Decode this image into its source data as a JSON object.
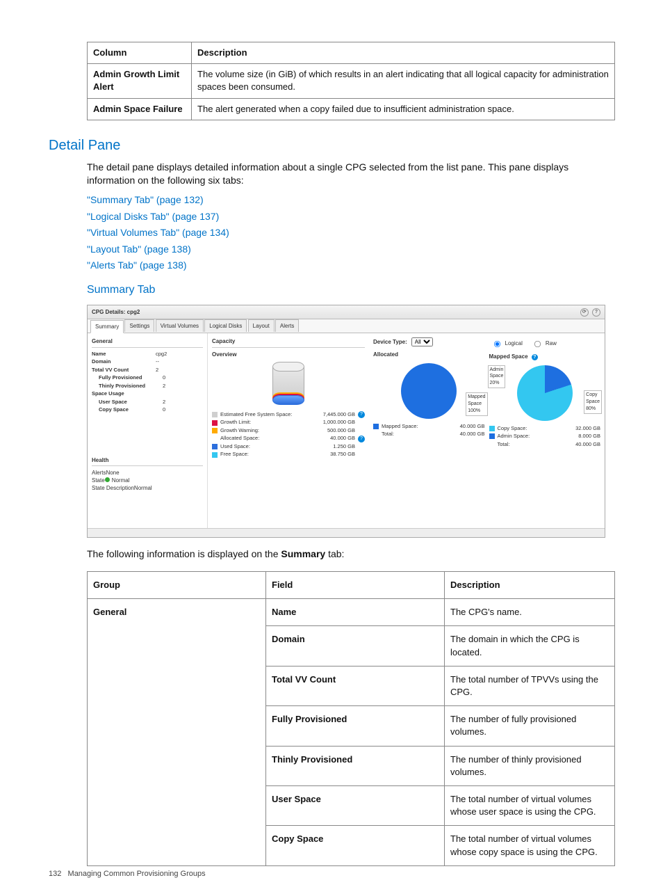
{
  "top_table": {
    "headers": [
      "Column",
      "Description"
    ],
    "rows": [
      {
        "col": "Admin Growth Limit Alert",
        "desc": "The volume size (in GiB) of which results in an alert indicating that all logical capacity for administration spaces been consumed."
      },
      {
        "col": "Admin Space Failure",
        "desc": "The alert generated when a copy failed due to insufficient administration space."
      }
    ]
  },
  "section_heading": "Detail Pane",
  "intro": "The detail pane displays detailed information about a single CPG selected from the list pane. This pane displays information on the following six tabs:",
  "links": [
    "\"Summary Tab\" (page 132)",
    "\"Logical Disks Tab\" (page 137)",
    "\"Virtual Volumes Tab\" (page 134)",
    "\"Layout Tab\" (page 138)",
    "\"Alerts Tab\" (page 138)"
  ],
  "subheading": "Summary Tab",
  "screenshot": {
    "title": "CPG Details: cpg2",
    "tabs": [
      "Summary",
      "Settings",
      "Virtual Volumes",
      "Logical Disks",
      "Layout",
      "Alerts"
    ],
    "general_title": "General",
    "capacity_title": "Capacity",
    "general": [
      {
        "k": "Name",
        "v": "cpg2"
      },
      {
        "k": "Domain",
        "v": "--"
      },
      {
        "k": "Total VV Count",
        "v": "2"
      },
      {
        "k": "Fully Provisioned",
        "v": "0",
        "ind": true
      },
      {
        "k": "Thinly Provisioned",
        "v": "2",
        "ind": true
      },
      {
        "k": "Space Usage",
        "v": ""
      },
      {
        "k": "User Space",
        "v": "2",
        "ind": true
      },
      {
        "k": "Copy Space",
        "v": "0",
        "ind": true
      }
    ],
    "overview_title": "Overview",
    "overview_legend": [
      {
        "color": "#cfcfcf",
        "label": "Estimated Free System Space:",
        "value": "7,445.000 GB",
        "help": true
      },
      {
        "color": "#d14",
        "label": "Growth Limit:",
        "value": "1,000.000 GB"
      },
      {
        "color": "#fa0",
        "label": "Growth Warning:",
        "value": "500.000 GB"
      },
      {
        "color": "",
        "label": "Allocated Space:",
        "value": "40.000 GB",
        "help": true,
        "nobox": true
      },
      {
        "color": "#2d6fdc",
        "label": "Used Space:",
        "value": "1.250 GB"
      },
      {
        "color": "#33c7f0",
        "label": "Free Space:",
        "value": "38.750 GB"
      }
    ],
    "device_type_label": "Device Type:",
    "device_type_value": "All",
    "radio_logical": "Logical",
    "radio_raw": "Raw",
    "allocated": {
      "title": "Allocated",
      "pie_label": "Mapped\nSpace\n100%",
      "rows": [
        {
          "color": "#1e6fe0",
          "label": "Mapped Space:",
          "value": "40.000 GB"
        },
        {
          "label": "Total:",
          "value": "40.000 GB"
        }
      ]
    },
    "mapped": {
      "title": "Mapped Space",
      "pie_labels": [
        "Admin\nSpace\n20%",
        "Copy\nSpace\n80%"
      ],
      "rows": [
        {
          "color": "#33c7f0",
          "label": "Copy Space:",
          "value": "32.000 GB"
        },
        {
          "color": "#1e6fe0",
          "label": "Admin Space:",
          "value": "8.000 GB"
        },
        {
          "label": "Total:",
          "value": "40.000 GB"
        }
      ]
    },
    "health": {
      "title": "Health",
      "rows": [
        {
          "k": "Alerts",
          "v": "None"
        },
        {
          "k": "State",
          "v": "Normal",
          "dot": true
        },
        {
          "k": "State Description",
          "v": "Normal"
        }
      ]
    }
  },
  "summary_intro_prefix": "The following information is displayed on the ",
  "summary_intro_bold": "Summary",
  "summary_intro_suffix": " tab:",
  "field_table": {
    "headers": [
      "Group",
      "Field",
      "Description"
    ],
    "group": "General",
    "rows": [
      {
        "field": "Name",
        "desc": "The CPG's name."
      },
      {
        "field": "Domain",
        "desc": "The domain in which the CPG is located."
      },
      {
        "field": "Total VV Count",
        "desc": "The total number of TPVVs using the CPG."
      },
      {
        "field": "Fully Provisioned",
        "desc": "The number of fully provisioned volumes."
      },
      {
        "field": "Thinly Provisioned",
        "desc": "The number of thinly provisioned volumes."
      },
      {
        "field": "User Space",
        "desc": "The total number of virtual volumes whose user space is using the CPG."
      },
      {
        "field": "Copy Space",
        "desc": "The total number of virtual volumes whose copy space is using the CPG."
      }
    ]
  },
  "footer": {
    "page": "132",
    "text": "Managing Common Provisioning Groups"
  }
}
